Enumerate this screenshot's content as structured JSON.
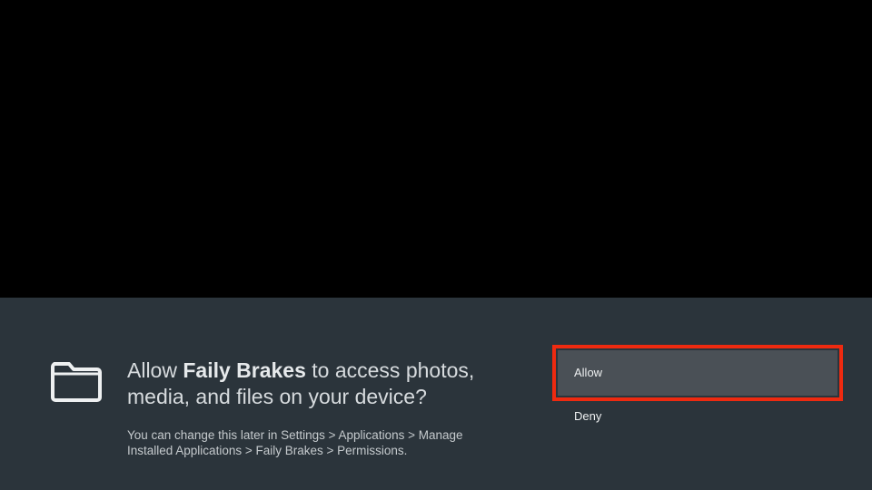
{
  "dialog": {
    "icon": "folder-icon",
    "title_prefix": "Allow ",
    "app_name": "Faily Brakes",
    "title_suffix": " to access photos, media, and files on your device?",
    "hint": "You can change this later in Settings > Applications > Manage Installed Applications > Faily Brakes > Permissions."
  },
  "actions": {
    "allow_label": "Allow",
    "deny_label": "Deny",
    "focused": "Allow",
    "focus_color": "#ee2a10"
  },
  "colors": {
    "panel": "#2b343b",
    "backdrop": "#000000",
    "button_focused": "#4a5056"
  }
}
